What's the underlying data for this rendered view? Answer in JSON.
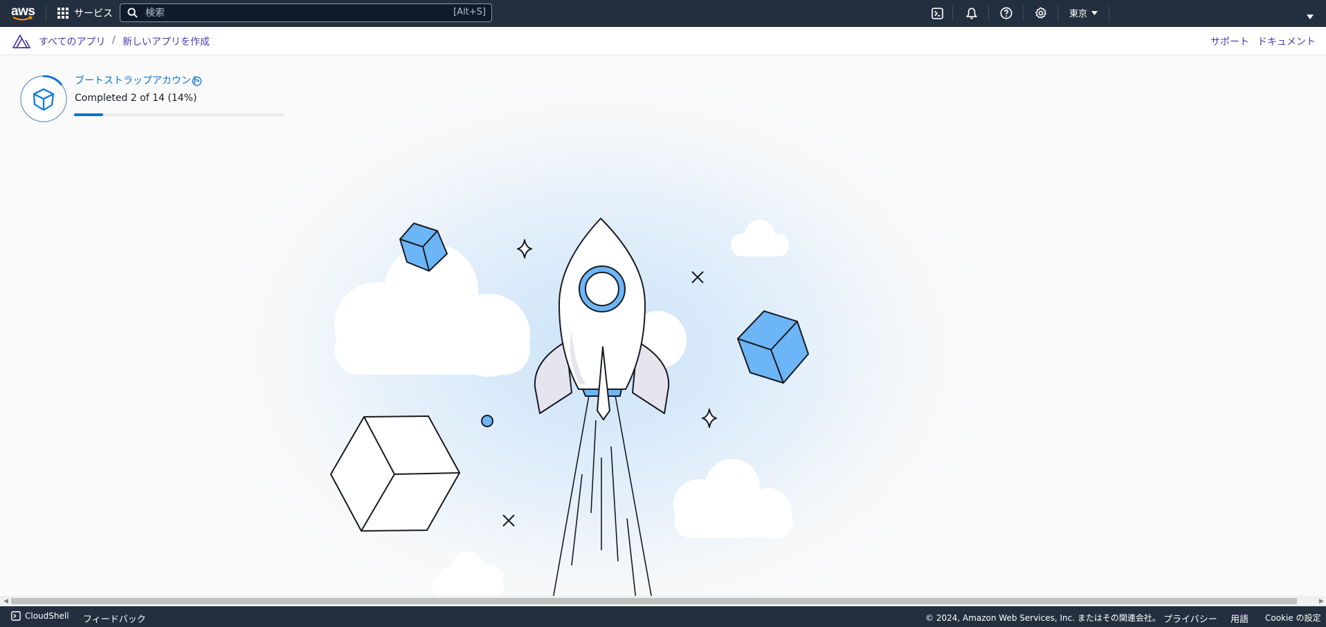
{
  "topbar": {
    "logo_text": "aws",
    "services_label": "サービス",
    "search_placeholder": "検索",
    "search_shortcut": "[Alt+S]",
    "region_label": "東京",
    "icons": [
      "grid-icon",
      "search-icon",
      "cloudshell-icon",
      "bell-icon",
      "help-icon",
      "gear-icon",
      "caret-down-icon"
    ]
  },
  "breadcrumb": {
    "items": [
      {
        "label": "すべてのアプリ"
      },
      {
        "label": "新しいアプリを作成"
      }
    ],
    "separator": "/",
    "right_links": [
      {
        "label": "サポート"
      },
      {
        "label": "ドキュメント"
      }
    ]
  },
  "progress": {
    "title": "ブートストラップアカウント",
    "status": "Completed 2 of 14 (14%)",
    "completed": 2,
    "total": 14,
    "fraction": 0.14,
    "icon": "cube-icon"
  },
  "footer": {
    "cloudshell_label": "CloudShell",
    "feedback_label": "フィードバック",
    "copyright": "© 2024, Amazon Web Services, Inc. またはその関連会社。",
    "links": [
      {
        "label": "プライバシー"
      },
      {
        "label": "用語"
      },
      {
        "label": "Cookie の設定"
      }
    ]
  },
  "colors": {
    "nav_bg": "#232f3e",
    "link": "#4d38b3",
    "progress": "#0972d3",
    "cube_blue": "#6cb5f6"
  }
}
